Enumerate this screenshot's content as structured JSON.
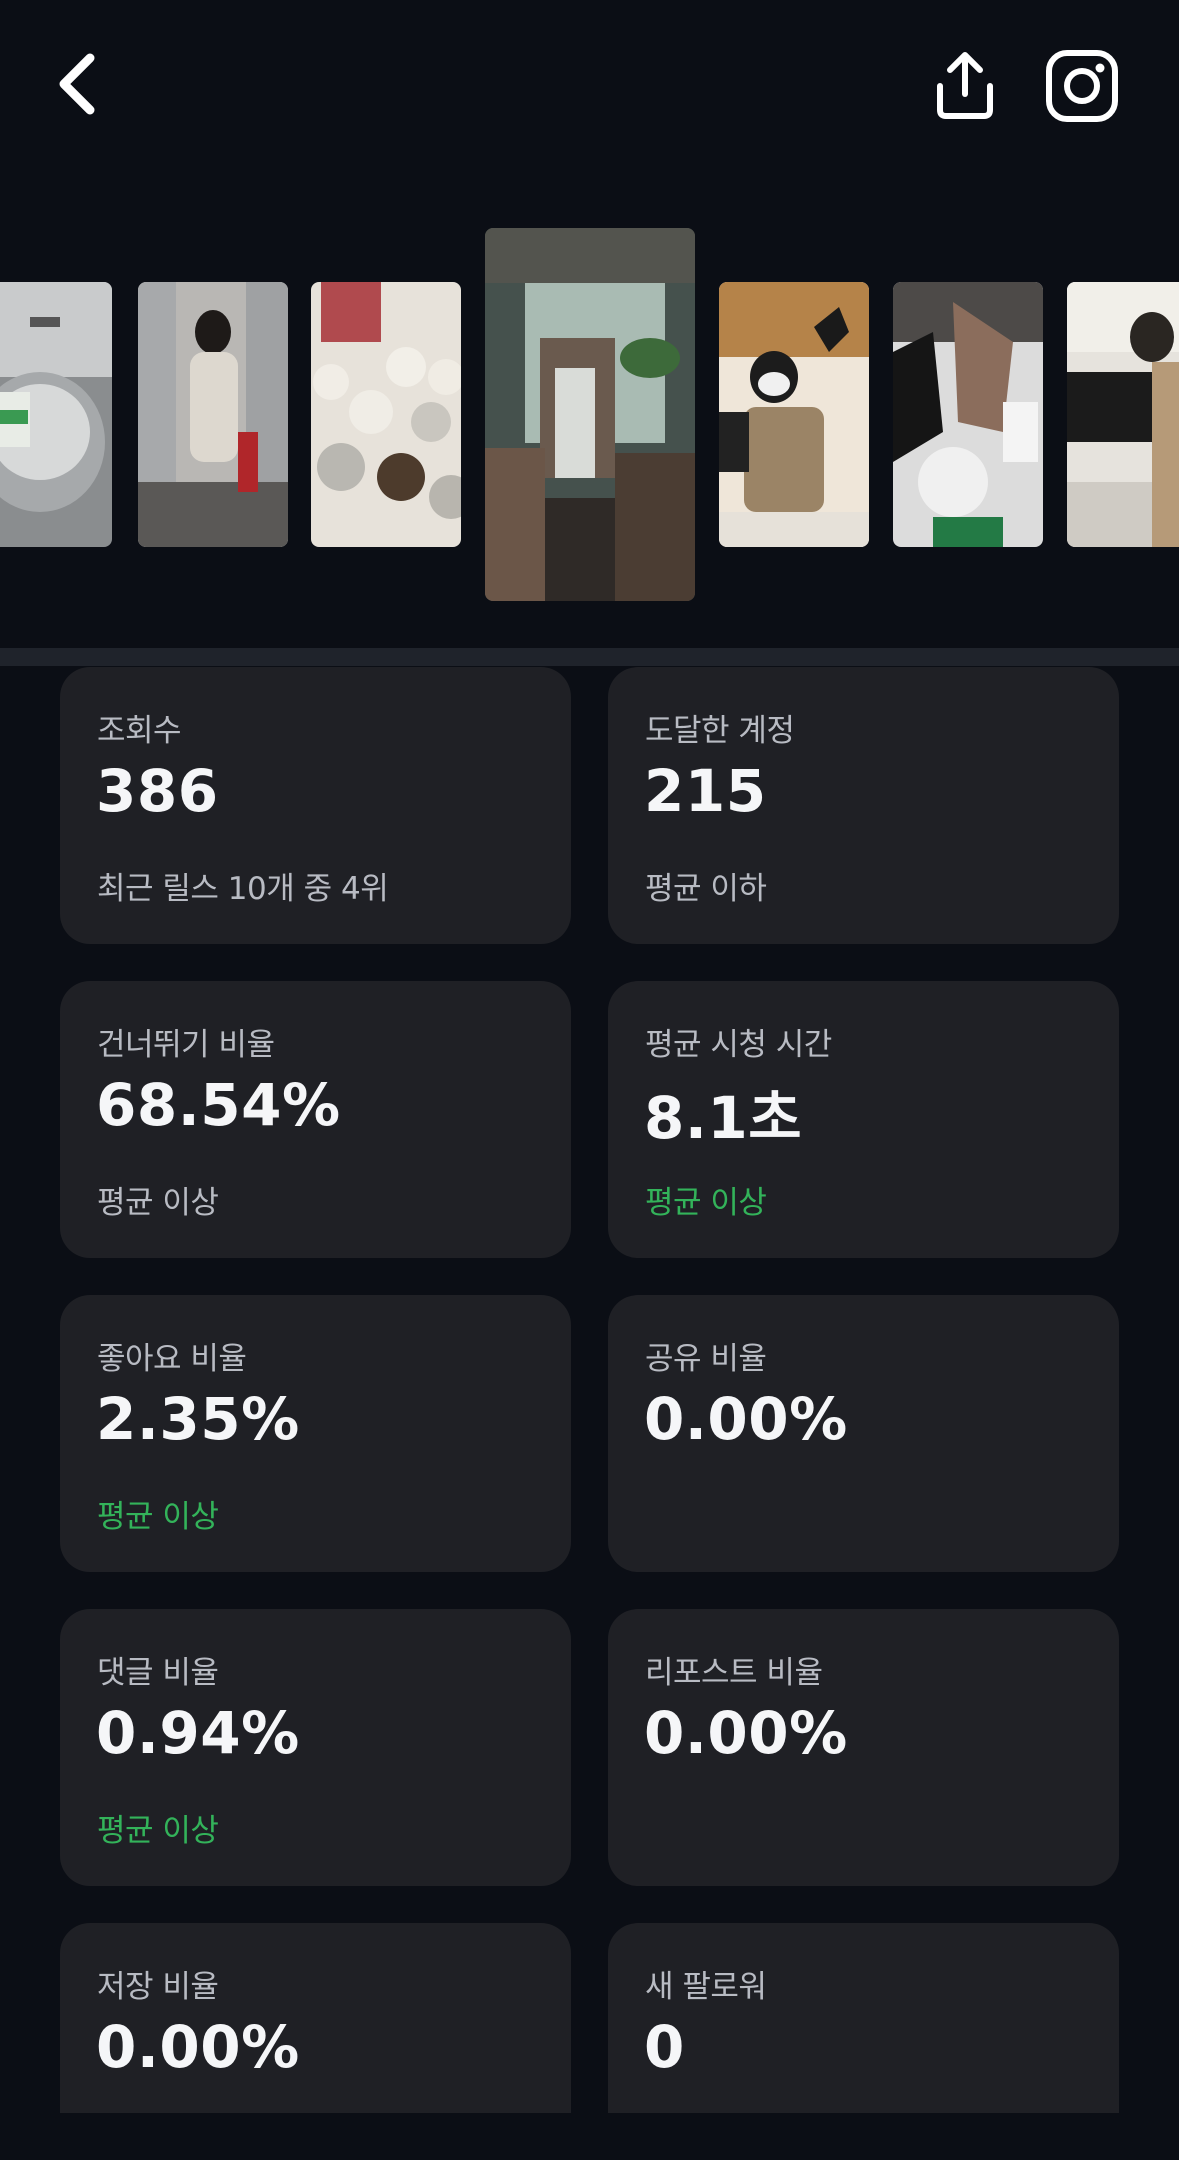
{
  "header": {
    "back_icon": "chevron-left-icon",
    "share_icon": "share-upload-icon",
    "instagram_icon": "instagram-icon"
  },
  "thumbnails": [
    {
      "name": "thumb-1"
    },
    {
      "name": "thumb-2"
    },
    {
      "name": "thumb-3"
    },
    {
      "name": "thumb-selected"
    },
    {
      "name": "thumb-5"
    },
    {
      "name": "thumb-6"
    },
    {
      "name": "thumb-7"
    }
  ],
  "stats": {
    "views": {
      "label": "조회수",
      "value": "386",
      "note": "최근 릴스 10개 중 4위"
    },
    "reach": {
      "label": "도달한 계정",
      "value": "215",
      "note": "평균 이하"
    },
    "skip_rate": {
      "label": "건너뛰기 비율",
      "value": "68.54%",
      "note": "평균 이상"
    },
    "avg_watch": {
      "label": "평균 시청 시간",
      "value": "8.1초",
      "note": "평균 이상"
    },
    "like_rate": {
      "label": "좋아요 비율",
      "value": "2.35%",
      "note": "평균 이상"
    },
    "share_rate": {
      "label": "공유 비율",
      "value": "0.00%"
    },
    "comment_rate": {
      "label": "댓글 비율",
      "value": "0.94%",
      "note": "평균 이상"
    },
    "repost_rate": {
      "label": "리포스트 비율",
      "value": "0.00%"
    },
    "save_rate": {
      "label": "저장 비율",
      "value": "0.00%"
    },
    "new_followers": {
      "label": "새 팔로워",
      "value": "0"
    }
  },
  "colors": {
    "background": "#0b0e15",
    "card": "#1f2025",
    "positive": "#33b35a",
    "muted_text": "#b8bbc3"
  }
}
